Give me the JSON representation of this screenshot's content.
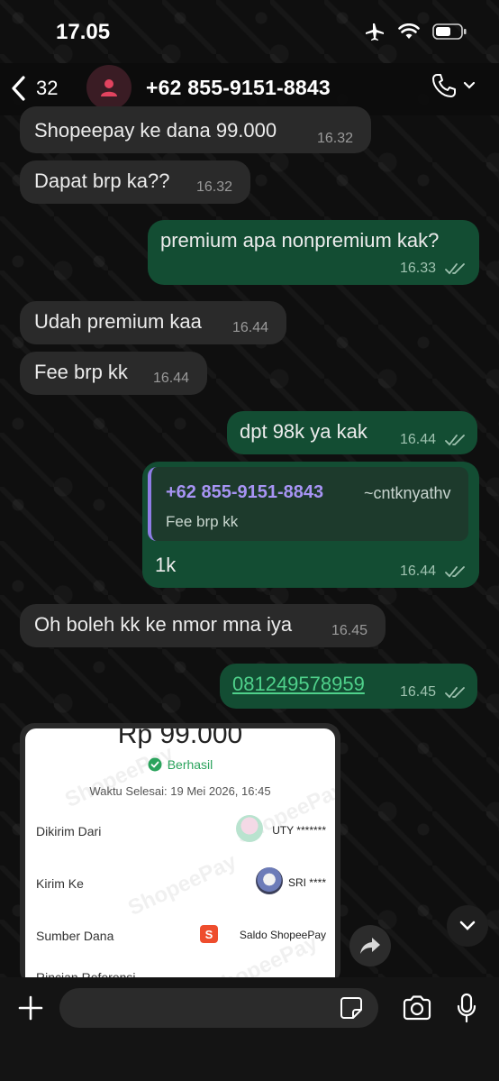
{
  "status_bar": {
    "time": "17.05",
    "icons": [
      "airplane-icon",
      "wifi-icon",
      "battery-icon"
    ]
  },
  "header": {
    "back_count": "32",
    "contact_name": "+62 855-9151-8843",
    "icons": [
      "chevron-left-icon",
      "person-icon",
      "phone-icon",
      "chevron-down-icon"
    ]
  },
  "messages": [
    {
      "direction": "in",
      "text": "Shopeepay ke dana 99.000",
      "time": "16.32"
    },
    {
      "direction": "in",
      "text": "Dapat brp ka??",
      "time": "16.32"
    },
    {
      "direction": "out",
      "text": "premium apa nonpremium kak?",
      "time": "16.33",
      "read": true
    },
    {
      "direction": "in",
      "text": "Udah premium kaa",
      "time": "16.44"
    },
    {
      "direction": "in",
      "text": "Fee brp kk",
      "time": "16.44"
    },
    {
      "direction": "out",
      "text": "dpt 98k ya kak",
      "time": "16.44",
      "read": true
    },
    {
      "direction": "out",
      "text": "1k",
      "time": "16.44",
      "read": true,
      "reply_to": {
        "name": "+62 855-9151-8843",
        "alias": "~cntknyathv",
        "text": "Fee brp kk"
      }
    },
    {
      "direction": "in",
      "text": "Oh boleh kk ke nmor mna iya",
      "time": "16.45"
    },
    {
      "direction": "out",
      "text": "081249578959",
      "time": "16.45",
      "read": true,
      "is_link": true
    }
  ],
  "receipt": {
    "amount": "Rp 99.000",
    "status": "Berhasil",
    "completed_time": "Waktu Selesai: 19 Mei 2026, 16:45",
    "rows": [
      {
        "label": "Dikirim Dari",
        "value": "UTY *******"
      },
      {
        "label": "Kirim Ke",
        "value": "SRI ****"
      },
      {
        "label": "Sumber Dana",
        "value": "Saldo ShopeePay"
      },
      {
        "label": "Rincian Referensi",
        "value": ""
      }
    ],
    "watermark": "ShopeePay",
    "colors": {
      "success": "#2aa35c",
      "shopee": "#ee4d2d"
    }
  },
  "input": {
    "placeholder": "",
    "value": ""
  },
  "colors": {
    "incoming_bubble": "#2a2a2a",
    "outgoing_bubble": "#134d33",
    "link": "#4fd18b",
    "reply_name": "#a794f4",
    "read_ticks": "#9fc2b0"
  }
}
